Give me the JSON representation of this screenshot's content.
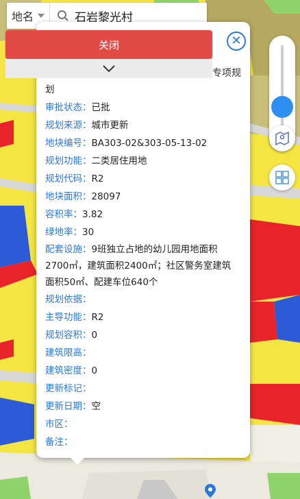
{
  "topbar": {
    "category": "地名",
    "search_value": "石岩黎光村"
  },
  "popup": {
    "close_label": "关闭",
    "title_tail": "专项规",
    "title_cont": "划",
    "rows": [
      {
        "k": "审批状态",
        "v": "已批"
      },
      {
        "k": "规划来源",
        "v": "城市更新"
      },
      {
        "k": "地块编号",
        "v": "BA303-02&303-05-13-02"
      },
      {
        "k": "规划功能",
        "v": "二类居住用地"
      },
      {
        "k": "规划代码",
        "v": "R2"
      },
      {
        "k": "地块面积",
        "v": "28097"
      },
      {
        "k": "容积率",
        "v": "3.82"
      },
      {
        "k": "绿地率",
        "v": "30"
      }
    ],
    "facility": {
      "k": "配套设施",
      "line1": "9班独立占地的幼儿园用地面积",
      "line2": "2700㎡，建筑面积2400㎡；社区警务室建筑",
      "line3": "面积50㎡、配建车位640个"
    },
    "rows2": [
      {
        "k": "规划依据",
        "v": ""
      },
      {
        "k": "主导功能",
        "v": "R2"
      },
      {
        "k": "规划容积",
        "v": "0"
      },
      {
        "k": "建筑限高",
        "v": ""
      },
      {
        "k": "建筑密度",
        "v": "0"
      },
      {
        "k": "更新标记",
        "v": ""
      },
      {
        "k": "更新日期",
        "v": "空"
      },
      {
        "k": "市区",
        "v": ""
      },
      {
        "k": "备注",
        "v": ""
      }
    ]
  },
  "colors": {
    "accent": "#2b78d8",
    "close_button": "#e24a45",
    "map_yellow": "#f4e542",
    "map_red": "#e8232a",
    "map_blue": "#2d5bd8",
    "map_olive": "#b5a860"
  },
  "icons": [
    "search-icon",
    "close-icon",
    "chevron-down-icon",
    "map-layers-icon",
    "grid-icon",
    "location-pin-icon"
  ]
}
